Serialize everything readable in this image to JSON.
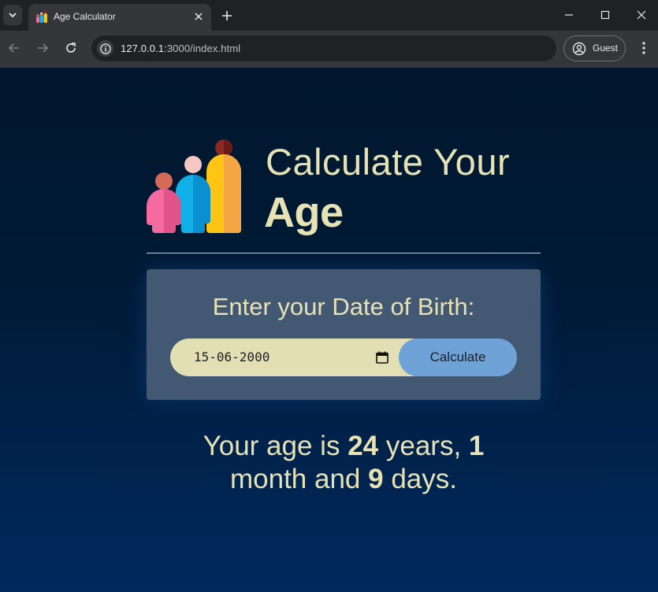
{
  "browser": {
    "tab_title": "Age Calculator",
    "url_host": "127.0.0.1",
    "url_path": ":3000/index.html",
    "profile_label": "Guest"
  },
  "header": {
    "line1": "Calculate Your",
    "line2": "Age",
    "logo_icon": "family-icon"
  },
  "form": {
    "prompt": "Enter your Date of Birth:",
    "dob_value": "15-06-2000",
    "button_label": "Calculate"
  },
  "result": {
    "prefix": "Your age is",
    "years": "24",
    "years_word": "years,",
    "months": "1",
    "months_word": "month and",
    "days": "9",
    "days_word": "days."
  },
  "colors": {
    "accent_text": "#e6e2b4",
    "button": "#6fa3d7",
    "card": "#435873"
  }
}
